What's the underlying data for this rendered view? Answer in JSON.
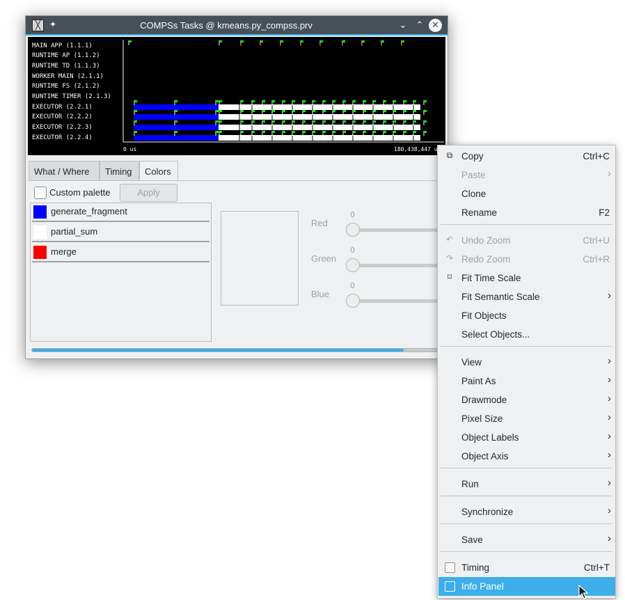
{
  "window": {
    "title": "COMPSs Tasks @ kmeans.py_compss.prv",
    "app_icon": "paraver-icon",
    "buttons": [
      "pin-icon",
      "minimize-icon",
      "maximize-icon",
      "close-icon"
    ]
  },
  "timeline": {
    "rows": [
      "MAIN APP (1.1.1)",
      "RUNTIME AP (1.1.2)",
      "RUNTIME TD (1.1.3)",
      "WORKER MAIN (2.1.1)",
      "RUNTIME FS (2.1.2)",
      "RUNTIME TIMER (2.1.3)",
      "EXECUTOR (2.2.1)",
      "EXECUTOR (2.2.2)",
      "EXECUTOR (2.2.3)",
      "EXECUTOR (2.2.4)"
    ],
    "time_start": "0 us",
    "time_end": "180,438,447 u",
    "colors": {
      "background": "#000000",
      "generate_fragment": "#0000ff",
      "partial_sum": "#ffffff",
      "merge": "#ff0000",
      "flag": "#00ff00"
    }
  },
  "tabs": [
    {
      "label": "What / Where",
      "active": false
    },
    {
      "label": "Timing",
      "active": false
    },
    {
      "label": "Colors",
      "active": true
    }
  ],
  "colors_page": {
    "custom_palette_label": "Custom palette",
    "custom_palette_checked": false,
    "apply_label": "Apply",
    "palette": [
      {
        "name": "generate_fragment",
        "color": "#0000ff"
      },
      {
        "name": "partial_sum",
        "color": "#ffffff"
      },
      {
        "name": "merge",
        "color": "#ff0000"
      }
    ],
    "sliders": [
      {
        "label": "Red",
        "value": "0"
      },
      {
        "label": "Green",
        "value": "0"
      },
      {
        "label": "Blue",
        "value": "0"
      }
    ],
    "progress": 0.9
  },
  "context_menu": {
    "items": [
      {
        "label": "Copy",
        "shortcut": "Ctrl+C",
        "icon": "copy-icon",
        "disabled": false
      },
      {
        "label": "Paste",
        "submenu": true,
        "disabled": true
      },
      {
        "label": "Clone"
      },
      {
        "label": "Rename",
        "shortcut": "F2"
      },
      {
        "label": "Undo Zoom",
        "shortcut": "Ctrl+U",
        "icon": "undo-icon",
        "disabled": true
      },
      {
        "label": "Redo Zoom",
        "shortcut": "Ctrl+R",
        "icon": "redo-icon",
        "disabled": true
      },
      {
        "label": "Fit Time Scale",
        "icon": "fit-icon"
      },
      {
        "label": "Fit Semantic Scale",
        "submenu": true
      },
      {
        "label": "Fit Objects"
      },
      {
        "label": "Select Objects..."
      },
      {
        "label": "View",
        "submenu": true
      },
      {
        "label": "Paint As",
        "submenu": true
      },
      {
        "label": "Drawmode",
        "submenu": true
      },
      {
        "label": "Pixel Size",
        "submenu": true
      },
      {
        "label": "Object Labels",
        "submenu": true
      },
      {
        "label": "Object Axis",
        "submenu": true
      },
      {
        "label": "Run",
        "submenu": true
      },
      {
        "label": "Synchronize",
        "submenu": true
      },
      {
        "label": "Save",
        "submenu": true
      },
      {
        "label": "Timing",
        "shortcut": "Ctrl+T",
        "checkbox": true,
        "checked": false
      },
      {
        "label": "Info Panel",
        "checkbox": true,
        "checked": false,
        "highlighted": true
      }
    ]
  }
}
